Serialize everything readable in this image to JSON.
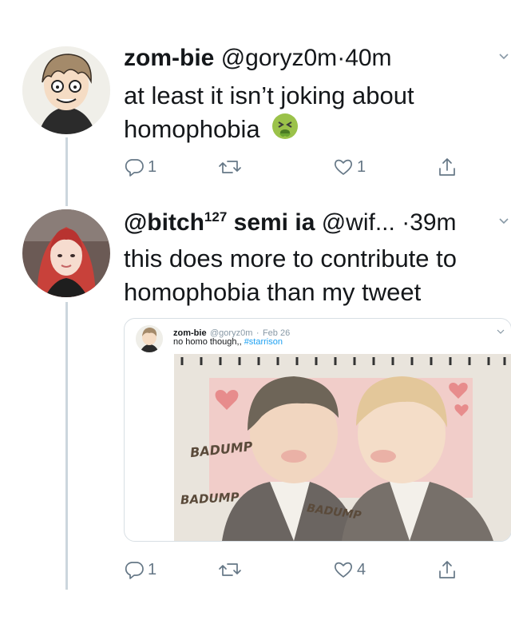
{
  "tweet1": {
    "name": "zom-bie",
    "handle": "@goryz0m",
    "separator": "·",
    "time": "40m",
    "text_line1": "at least it isn’t joking about",
    "text_line2": "homophobia",
    "emoji": "🤮",
    "actions": {
      "reply_count": "1",
      "retweet_count": "",
      "like_count": "1"
    }
  },
  "tweet2": {
    "name": "@bitch",
    "name_sup": "127",
    "name_rest": "semi ia",
    "handle": "@wif...",
    "separator": "·",
    "time": "39m",
    "text_line1": "this does more to contribute to",
    "text_line2": "homophobia than my tweet",
    "actions": {
      "reply_count": "1",
      "retweet_count": "",
      "like_count": "4"
    }
  },
  "quoted": {
    "name": "zom-bie",
    "handle": "@goryz0m",
    "separator": "·",
    "date": "Feb 26",
    "text": "no homo though,,",
    "hashtag": "#starrison",
    "image_text": [
      "BADUMP",
      "BADUMP",
      "BADUMP"
    ]
  },
  "icons": [
    "reply-icon",
    "retweet-icon",
    "like-icon",
    "share-icon",
    "chevron-down-icon"
  ],
  "colors": {
    "text": "#14171a",
    "muted": "#657786",
    "thread_line": "#ccd6dd",
    "link": "#1da1f2"
  }
}
